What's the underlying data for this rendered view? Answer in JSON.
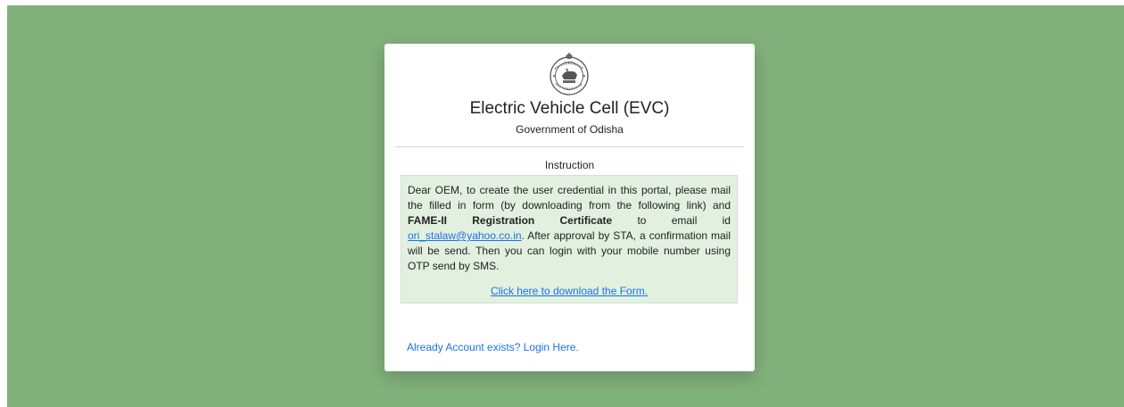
{
  "card": {
    "title": "Electric Vehicle Cell (EVC)",
    "subtitle": "Government of Odisha",
    "instruction_heading": "Instruction",
    "instruction": {
      "part1": "Dear OEM, to create the user credential in this portal, please mail the filled in form (by downloading from the following link) and ",
      "bold": "FAME-II Registration Certificate",
      "part2": " to email id ",
      "email": "ori_stalaw@yahoo.co.in",
      "part3": ". After approval by STA, a confirmation mail will be send. Then you can login with your mobile number using OTP send by SMS."
    },
    "download_link": "Click here to download the Form.",
    "login_link": "Already Account exists? Login Here."
  },
  "emblem": {
    "icon": "odisha-emblem-icon"
  },
  "colors": {
    "background": "#82b27c",
    "instruction_box": "#e2f0e0",
    "link": "#1a73e8"
  }
}
